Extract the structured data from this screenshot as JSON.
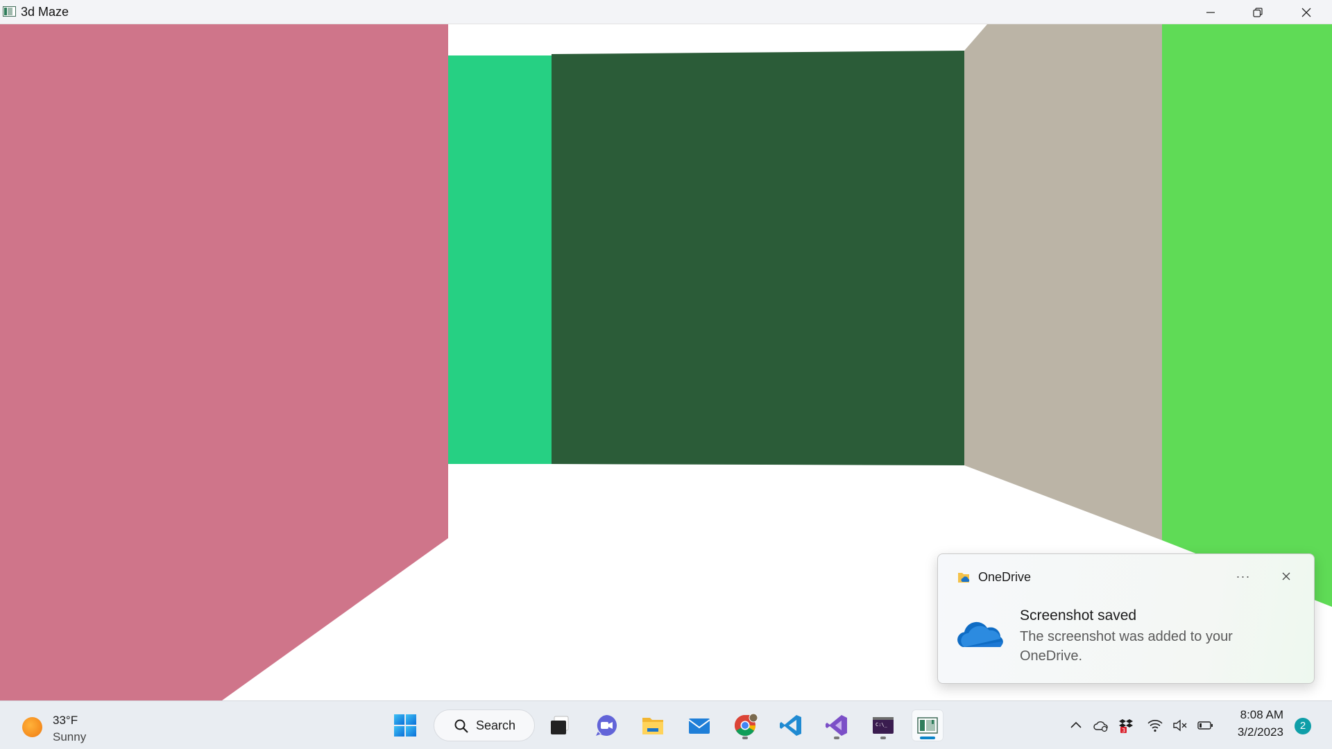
{
  "window": {
    "title": "3d Maze",
    "controls": {
      "minimize_icon": "minimize-icon",
      "restore_icon": "restore-icon",
      "close_icon": "close-icon"
    }
  },
  "scene": {
    "walls": [
      {
        "name": "left-wall",
        "color": "#cf758a"
      },
      {
        "name": "teal-wall",
        "color": "#26d083"
      },
      {
        "name": "back-wall",
        "color": "#2b5c38"
      },
      {
        "name": "right-side-wall",
        "color": "#bbb4a6"
      },
      {
        "name": "right-green-wall",
        "color": "#5fdb56"
      }
    ],
    "background_color": "#ffffff"
  },
  "toast": {
    "app_name": "OneDrive",
    "more_label": "···",
    "title": "Screenshot saved",
    "body": "The screenshot was added to your OneDrive.",
    "app_icon": "onedrive-icon",
    "close_icon": "close-icon"
  },
  "taskbar": {
    "weather": {
      "temperature": "33°F",
      "condition": "Sunny",
      "icon": "sun-icon"
    },
    "search_label": "Search",
    "apps": [
      {
        "name": "start",
        "icon": "windows-logo-icon"
      },
      {
        "name": "task-view",
        "icon": "task-view-icon"
      },
      {
        "name": "teams",
        "icon": "teams-chat-icon"
      },
      {
        "name": "file-explorer",
        "icon": "folder-icon"
      },
      {
        "name": "mail",
        "icon": "mail-icon"
      },
      {
        "name": "chrome",
        "icon": "chrome-icon",
        "running": true
      },
      {
        "name": "vscode",
        "icon": "vscode-icon"
      },
      {
        "name": "visual-studio",
        "icon": "visual-studio-icon",
        "running": true
      },
      {
        "name": "terminal",
        "icon": "terminal-icon",
        "running": true
      },
      {
        "name": "3d-maze",
        "icon": "maze-app-icon",
        "active": true
      }
    ],
    "tray": {
      "icons": [
        "chevron-up-icon",
        "onedrive-sync-icon",
        "dropbox-icon",
        "wifi-icon",
        "volume-muted-icon",
        "battery-icon"
      ],
      "dropbox_badge": "3",
      "time": "8:08 AM",
      "date": "3/2/2023",
      "notification_count": "2"
    }
  }
}
